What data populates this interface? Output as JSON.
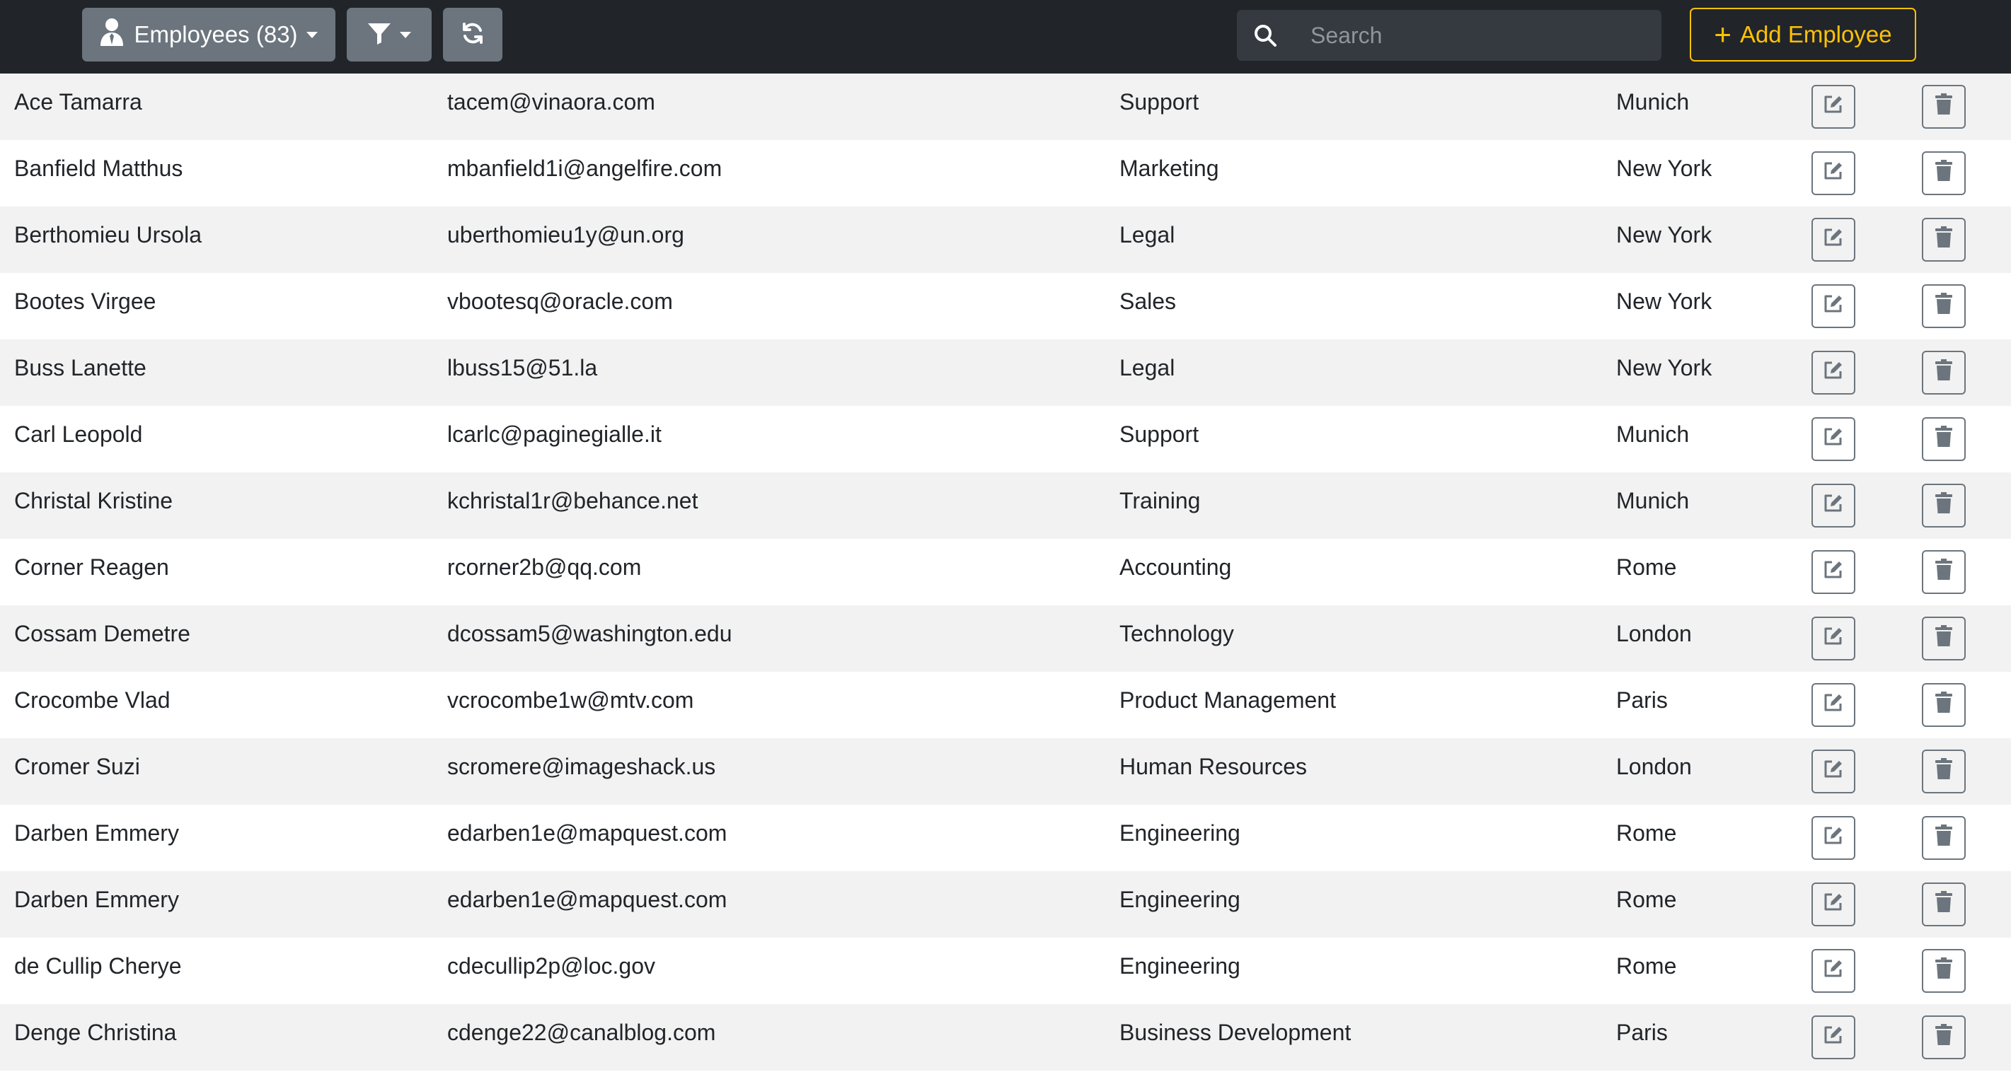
{
  "navbar": {
    "employees_label": "Employees (83)",
    "search_placeholder": "Search",
    "add_employee_label": "Add Employee"
  },
  "colors": {
    "navbar_bg": "#212529",
    "button_gray": "#6c757d",
    "accent_yellow": "#ffc107",
    "row_stripe": "#f2f2f2"
  },
  "icons": {
    "employees": "user-tie-icon",
    "filter": "filter-icon",
    "refresh": "refresh-icon",
    "search": "search-icon",
    "add": "plus-icon",
    "edit": "edit-icon",
    "delete": "trash-icon"
  },
  "employees": [
    {
      "name": "Ace Tamarra",
      "email": "tacem@vinaora.com",
      "department": "Support",
      "city": "Munich"
    },
    {
      "name": "Banfield Matthus",
      "email": "mbanfield1i@angelfire.com",
      "department": "Marketing",
      "city": "New York"
    },
    {
      "name": "Berthomieu Ursola",
      "email": "uberthomieu1y@un.org",
      "department": "Legal",
      "city": "New York"
    },
    {
      "name": "Bootes Virgee",
      "email": "vbootesq@oracle.com",
      "department": "Sales",
      "city": "New York"
    },
    {
      "name": "Buss Lanette",
      "email": "lbuss15@51.la",
      "department": "Legal",
      "city": "New York"
    },
    {
      "name": "Carl Leopold",
      "email": "lcarlc@paginegialle.it",
      "department": "Support",
      "city": "Munich"
    },
    {
      "name": "Christal Kristine",
      "email": "kchristal1r@behance.net",
      "department": "Training",
      "city": "Munich"
    },
    {
      "name": "Corner Reagen",
      "email": "rcorner2b@qq.com",
      "department": "Accounting",
      "city": "Rome"
    },
    {
      "name": "Cossam Demetre",
      "email": "dcossam5@washington.edu",
      "department": "Technology",
      "city": "London"
    },
    {
      "name": "Crocombe Vlad",
      "email": "vcrocombe1w@mtv.com",
      "department": "Product Management",
      "city": "Paris"
    },
    {
      "name": "Cromer Suzi",
      "email": "scromere@imageshack.us",
      "department": "Human Resources",
      "city": "London"
    },
    {
      "name": "Darben Emmery",
      "email": "edarben1e@mapquest.com",
      "department": "Engineering",
      "city": "Rome"
    },
    {
      "name": "Darben Emmery",
      "email": "edarben1e@mapquest.com",
      "department": "Engineering",
      "city": "Rome"
    },
    {
      "name": "de Cullip Cherye",
      "email": "cdecullip2p@loc.gov",
      "department": "Engineering",
      "city": "Rome"
    },
    {
      "name": "Denge Christina",
      "email": "cdenge22@canalblog.com",
      "department": "Business Development",
      "city": "Paris"
    }
  ]
}
